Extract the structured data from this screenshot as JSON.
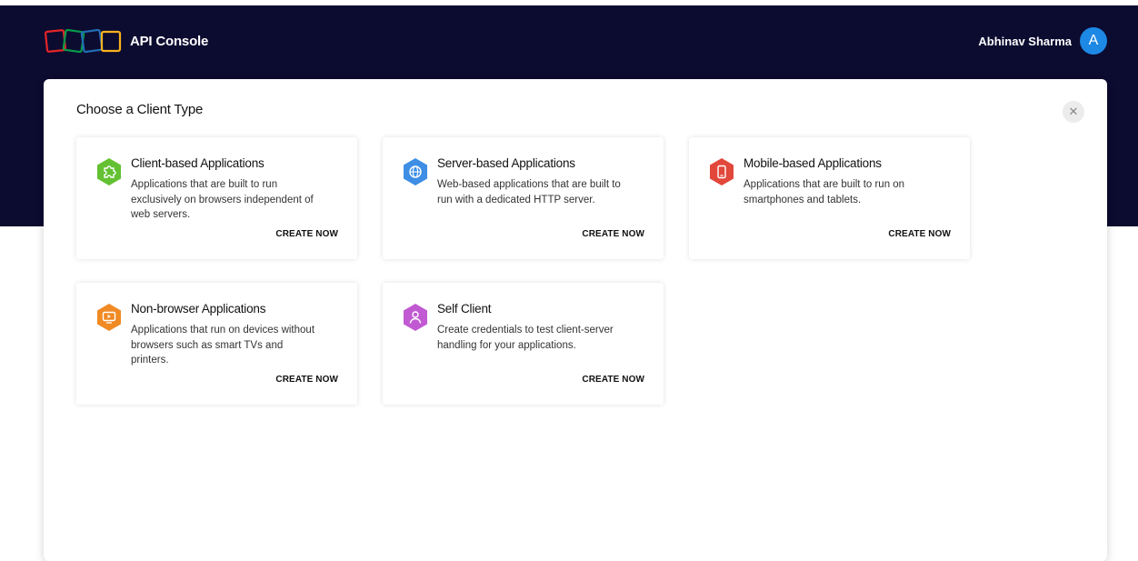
{
  "header": {
    "app_title": "API Console",
    "user_name": "Abhinav Sharma",
    "avatar_initial": "A",
    "bg_color": "#0c0b30",
    "avatar_color": "#1e88e5"
  },
  "modal": {
    "title": "Choose a Client Type",
    "close_icon": "close-icon",
    "cards": [
      {
        "title": "Client-based Applications",
        "description": "Applications that are built to run exclusively on browsers independent of web servers.",
        "action": "CREATE NOW",
        "icon": "puzzle-icon",
        "icon_color": "#63c132"
      },
      {
        "title": "Server-based Applications",
        "description": "Web-based applications that are built to run with a dedicated HTTP server.",
        "action": "CREATE NOW",
        "icon": "globe-icon",
        "icon_color": "#3d8ee4"
      },
      {
        "title": "Mobile-based Applications",
        "description": "Applications that are built to run on smartphones and tablets.",
        "action": "CREATE NOW",
        "icon": "mobile-icon",
        "icon_color": "#e2473b"
      },
      {
        "title": "Non-browser Applications",
        "description": "Applications that run on devices without browsers such as smart TVs and printers.",
        "action": "CREATE NOW",
        "icon": "tv-icon",
        "icon_color": "#f08a24"
      },
      {
        "title": "Self Client",
        "description": "Create credentials to test client-server handling for your applications.",
        "action": "CREATE NOW",
        "icon": "user-icon",
        "icon_color": "#c15ad2"
      }
    ]
  }
}
